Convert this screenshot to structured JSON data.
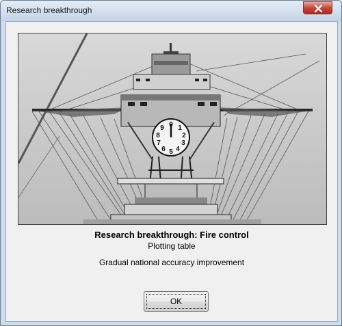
{
  "window": {
    "title": "Research breakthrough"
  },
  "dialog": {
    "image_alt": "Photograph of a warship fire-control tower with a range clock",
    "heading": "Research breakthrough: Fire control",
    "subheading": "Plotting table",
    "effect": "Gradual national accuracy improvement",
    "ok_label": "OK"
  },
  "icons": {
    "close": "close-icon"
  }
}
